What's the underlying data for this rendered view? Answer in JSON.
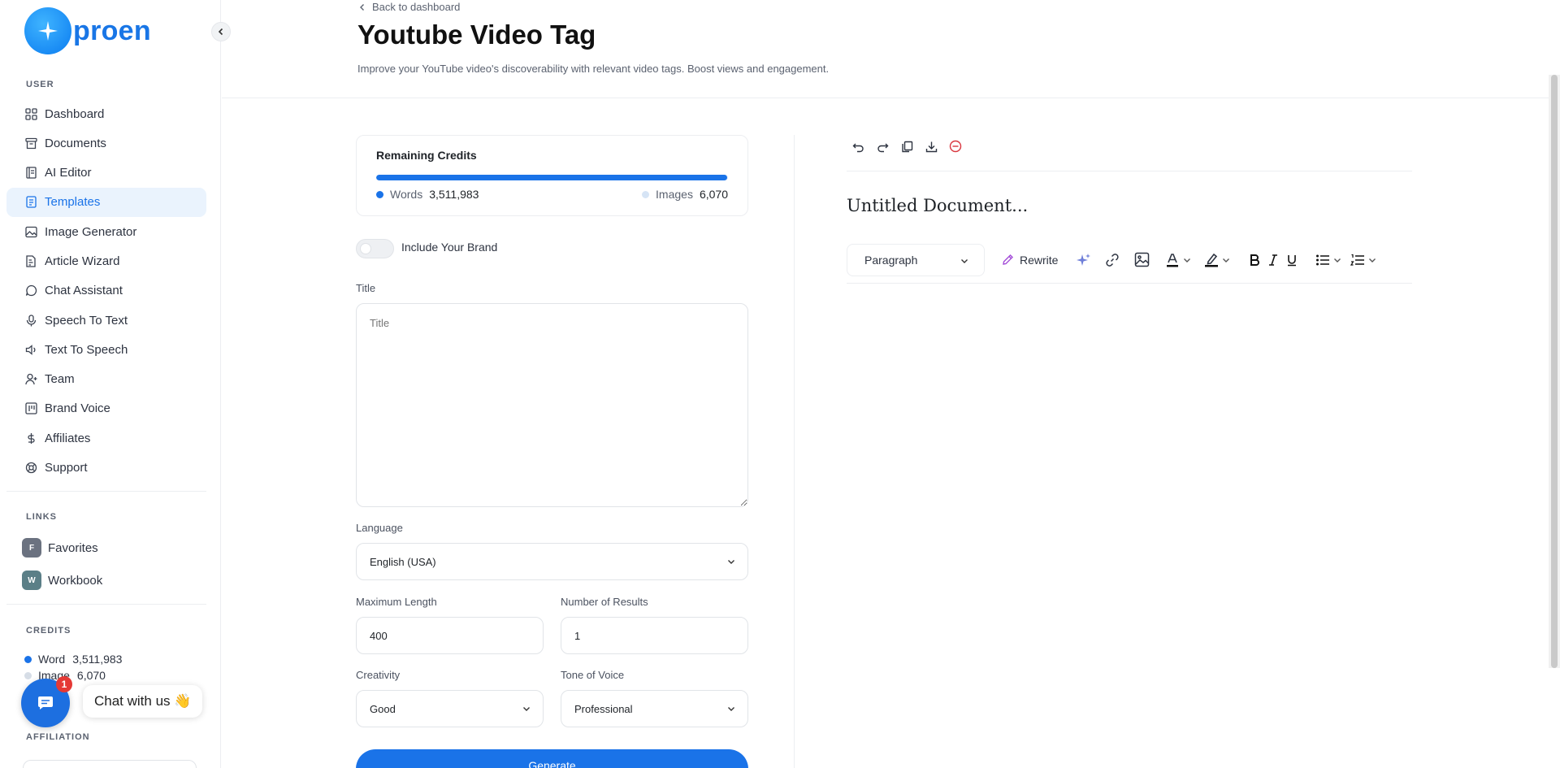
{
  "sidebar": {
    "logo_text": "proen",
    "section_user": "USER",
    "items": [
      {
        "label": "Dashboard"
      },
      {
        "label": "Documents"
      },
      {
        "label": "AI Editor"
      },
      {
        "label": "Templates"
      },
      {
        "label": "Image Generator"
      },
      {
        "label": "Article Wizard"
      },
      {
        "label": "Chat Assistant"
      },
      {
        "label": "Speech To Text"
      },
      {
        "label": "Text To Speech"
      },
      {
        "label": "Team"
      },
      {
        "label": "Brand Voice"
      },
      {
        "label": "Affiliates"
      },
      {
        "label": "Support"
      }
    ],
    "active_item": "Templates",
    "section_links": "LINKS",
    "links": [
      {
        "badge": "F",
        "label": "Favorites",
        "color": "#6b7280"
      },
      {
        "badge": "W",
        "label": "Workbook",
        "color": "#5b7f87"
      }
    ],
    "section_credits": "CREDITS",
    "credits": {
      "word_label": "Word",
      "word_value": "3,511,983",
      "image_label": "Image",
      "image_value": "6,070"
    },
    "section_affiliation": "AFFILIATION"
  },
  "chat": {
    "badge": "1",
    "label": "Chat with us 👋"
  },
  "header": {
    "back_label": "Back to dashboard",
    "title": "Youtube Video Tag",
    "description": "Improve your YouTube video's discoverability with relevant video tags. Boost views and engagement."
  },
  "form": {
    "credits_card": {
      "title": "Remaining Credits",
      "words_label": "Words",
      "words_value": "3,511,983",
      "images_label": "Images",
      "images_value": "6,070",
      "fill_fraction": 0.998
    },
    "brand_toggle_label": "Include Your Brand",
    "title_label": "Title",
    "title_placeholder": "Title",
    "language_label": "Language",
    "language_value": "English (USA)",
    "max_length_label": "Maximum Length",
    "max_length_value": "400",
    "num_results_label": "Number of Results",
    "num_results_value": "1",
    "creativity_label": "Creativity",
    "creativity_value": "Good",
    "tone_label": "Tone of Voice",
    "tone_value": "Professional",
    "generate_label": "Generate"
  },
  "editor": {
    "doc_title": "Untitled Document...",
    "paragraph_select": "Paragraph",
    "rewrite_label": "Rewrite"
  },
  "colors": {
    "accent": "#1a73e8",
    "active_bg": "#eaf3fd",
    "danger": "#d9363e"
  }
}
